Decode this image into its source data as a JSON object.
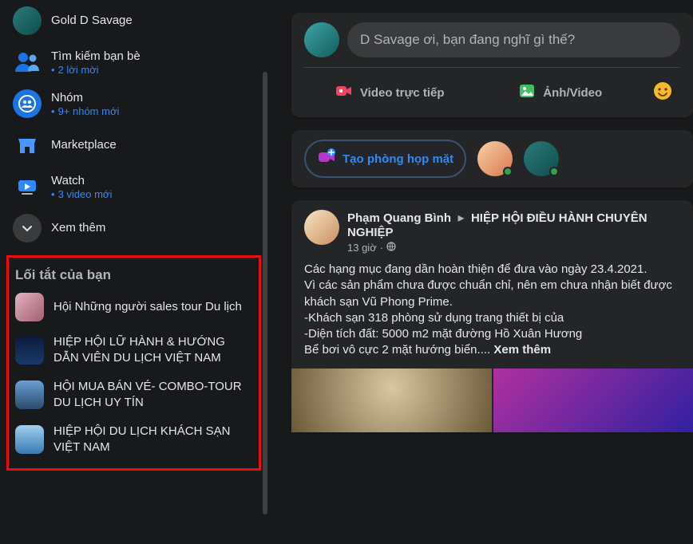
{
  "sidebar": {
    "profile": {
      "name": "Gold D Savage"
    },
    "items": [
      {
        "label": "Tìm kiếm bạn bè",
        "sub": "2 lời mời"
      },
      {
        "label": "Nhóm",
        "sub": "9+ nhóm mới"
      },
      {
        "label": "Marketplace",
        "sub": ""
      },
      {
        "label": "Watch",
        "sub": "3 video mới"
      }
    ],
    "see_more": "Xem thêm",
    "shortcuts_header": "Lối tắt của bạn",
    "shortcuts": [
      "Hội Những người sales tour Du lịch",
      "HIỆP HỘI LỮ HÀNH & HƯỚNG DẪN VIÊN DU LỊCH VIỆT NAM",
      "HỘI MUA BÁN VÉ- COMBO-TOUR DU LỊCH UY TÍN",
      "HIỆP HỘI DU LỊCH KHÁCH SẠN VIỆT NAM"
    ]
  },
  "composer": {
    "placeholder": "D Savage ơi, bạn đang nghĩ gì thế?",
    "live": "Video trực tiếp",
    "photo": "Ảnh/Video"
  },
  "rooms": {
    "create": "Tạo phòng họp mặt"
  },
  "post": {
    "author": "Phạm Quang Bình",
    "group": "HIỆP HỘI ĐIỀU HÀNH CHUYÊN NGHIỆP",
    "time": "13 giờ",
    "line1": "Các hạng mục đang dần hoàn thiện để đưa vào ngày 23.4.2021.",
    "line2": "Vì các sản phẩm chưa được chuẩn chỉ, nên em chưa nhận biết được khách sạn Vũ Phong Prime.",
    "line3": "-Khách sạn 318 phòng sử dụng trang thiết bị của",
    "line4": "-Diện tích đất: 5000 m2 mặt đường Hồ Xuân Hương",
    "line5": "Bể bơi vô cực 2 mặt hướng biển....",
    "see_more": "Xem thêm"
  }
}
